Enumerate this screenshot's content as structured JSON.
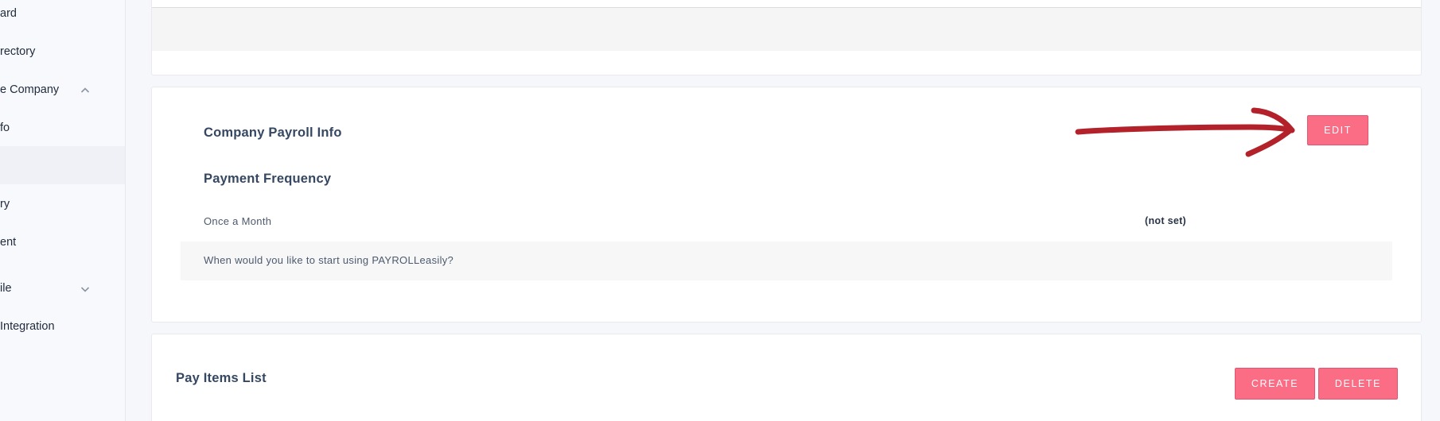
{
  "sidebar": {
    "items": [
      {
        "label": "ard"
      },
      {
        "label": "rectory"
      },
      {
        "label": "e Company"
      },
      {
        "label": "fo"
      },
      {
        "label": ""
      },
      {
        "label": "ry"
      },
      {
        "label": "ent"
      },
      {
        "label": "ile"
      },
      {
        "label": " Integration"
      }
    ]
  },
  "payroll_card": {
    "title": "Company Payroll Info",
    "edit_label": "EDIT",
    "frequency_heading": "Payment Frequency",
    "frequency_value": "Once a Month",
    "start_value": "(not set)",
    "start_question": "When would you like to start using PAYROLLeasily?"
  },
  "pay_items": {
    "title": "Pay Items List",
    "create_label": "CREATE",
    "delete_label": "DELETE"
  },
  "colors": {
    "accent": "#fb6c85",
    "arrow": "#b3222a"
  },
  "icons": {
    "company_chevron": "chevron-up-icon",
    "profile_chevron": "chevron-down-icon"
  }
}
